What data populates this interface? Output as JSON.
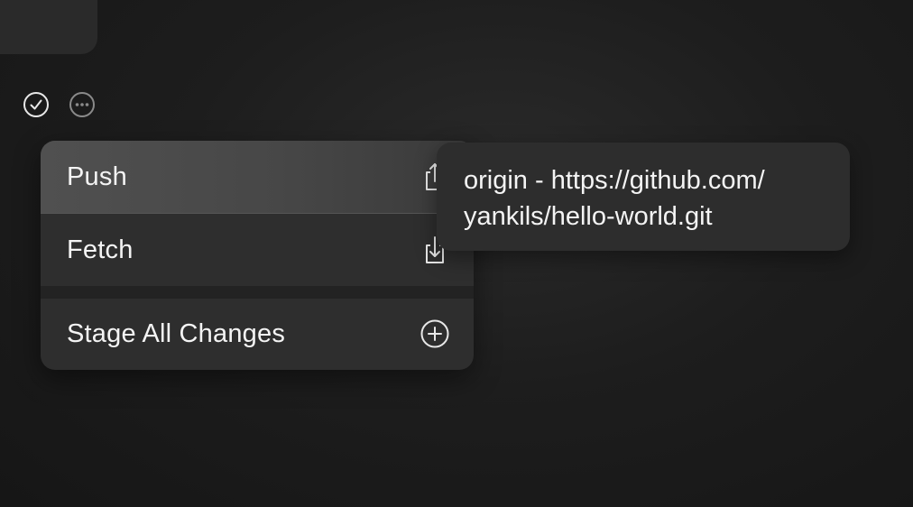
{
  "status_icons": {
    "check": "checkmark-circle-icon",
    "more": "ellipsis-circle-icon"
  },
  "menu": {
    "items": [
      {
        "label": "Push",
        "icon": "push-share-icon",
        "highlighted": true
      },
      {
        "label": "Fetch",
        "icon": "fetch-download-icon",
        "highlighted": false
      },
      {
        "label": "Stage All Changes",
        "icon": "plus-circle-icon",
        "highlighted": false
      }
    ]
  },
  "tooltip": {
    "line1": "origin - https://github.com/",
    "line2": "yankils/hello-world.git"
  },
  "colors": {
    "background": "#1a1a1a",
    "menu": "#2e2e2e",
    "highlight": "#4c4c4c",
    "text": "#f4f4f4"
  }
}
